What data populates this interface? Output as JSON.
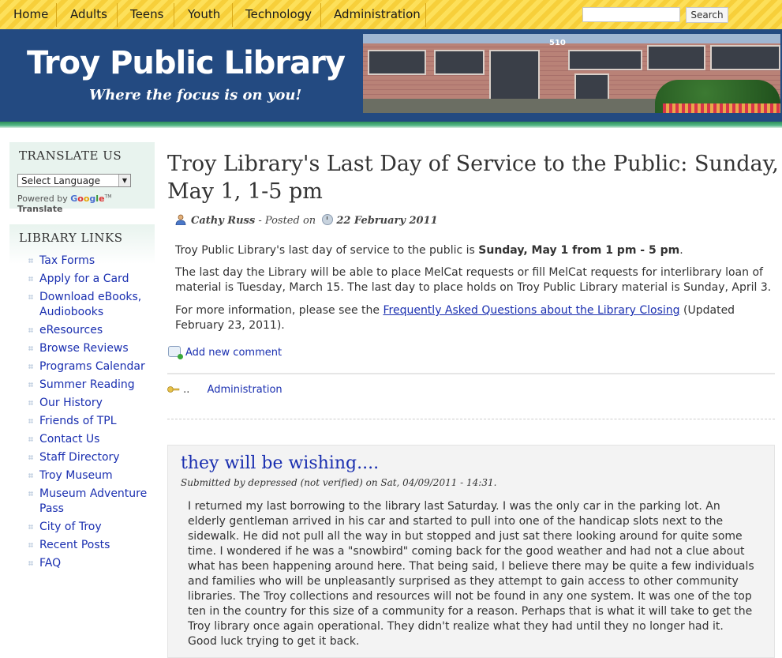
{
  "nav": {
    "items": [
      "Home",
      "Adults",
      "Teens",
      "Youth",
      "Technology",
      "Administration"
    ],
    "search_placeholder": "",
    "search_button": "Search"
  },
  "header": {
    "title": "Troy Public Library",
    "tagline": "Where the focus is on you!",
    "building_number": "510"
  },
  "sidebar": {
    "translate": {
      "heading": "TRANSLATE US",
      "select_value": "Select Language",
      "powered_prefix": "Powered by",
      "powered_suffix": "Translate"
    },
    "library_links": {
      "heading": "LIBRARY LINKS",
      "items": [
        "Tax Forms",
        "Apply for a Card",
        "Download eBooks, Audiobooks",
        "eResources",
        "Browse Reviews",
        "Programs Calendar",
        "Summer Reading",
        "Our History",
        "Friends of TPL",
        "Contact Us",
        "Staff Directory",
        "Troy Museum",
        "Museum Adventure Pass",
        "City of Troy",
        "Recent Posts",
        "FAQ"
      ]
    }
  },
  "article": {
    "title": "Troy Library's Last Day of Service to the Public: Sunday, May 1, 1-5 pm",
    "author": "Cathy Russ",
    "posted_on": "- Posted on",
    "date": "22 February 2011",
    "p1_text": "Troy Public Library's last day of service to the public is ",
    "p1_bold": "Sunday, May 1 from 1 pm - 5 pm",
    "p1_end": ".",
    "p2": "The last day the Library will be able to place MelCat requests or fill MelCat requests for interlibrary loan of material is Tuesday, March 15. The last day to place holds on Troy Public Library material is Sunday, April 3.",
    "p3_text": "For more information, please see the ",
    "p3_link": "Frequently Asked Questions about the Library Closing",
    "p3_end": " (Updated February 23, 2011).",
    "add_comment": "Add new comment",
    "tags_dots": "..",
    "tag": "Administration"
  },
  "comment": {
    "title": "they will be wishing....",
    "submitted": "Submitted by depressed (not verified) on Sat, 04/09/2011 - 14:31.",
    "body": "I returned my last borrowing to the library last Saturday.  I was the only car in the parking lot.  An elderly gentleman arrived in his car and started to pull into one of the handicap slots next to the sidewalk.  He did not pull all the way in but stopped and just sat there looking around for quite some time.  I wondered if he was a \"snowbird\" coming back for the good weather and had not a clue about what has been happening around here.  That being said, I believe there may be quite a few individuals and families who will be unpleasantly surprised as they attempt to gain access to other community libraries.  The Troy collections and resources will not be found in any one system.  It was one of the top ten in the country for this size of a community for a reason.  Perhaps that is what it will take to get the Troy library once again operational.  They didn't realize what they had until they no longer had it.  Good luck trying to get it back."
  }
}
